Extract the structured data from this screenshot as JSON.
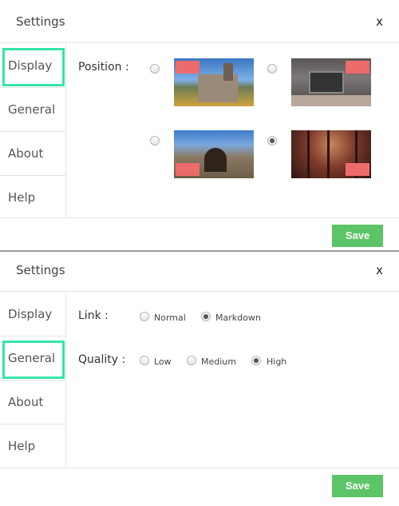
{
  "panels": [
    {
      "title": "Settings",
      "close": "x",
      "nav": [
        "Display",
        "General",
        "About",
        "Help"
      ],
      "active_nav": "Display",
      "position_label": "Position :",
      "positions": [
        {
          "image": "castle-tower",
          "checked": false
        },
        {
          "image": "laptop-desk",
          "checked": false
        },
        {
          "image": "castle-gate",
          "checked": true
        },
        {
          "image": "foggy-forest",
          "checked": false
        }
      ],
      "save_label": "Save"
    },
    {
      "title": "Settings",
      "close": "x",
      "nav": [
        "Display",
        "General",
        "About",
        "Help"
      ],
      "active_nav": "General",
      "link_label": "Link :",
      "link_options": [
        {
          "label": "Normal",
          "checked": false
        },
        {
          "label": "Markdown",
          "checked": true
        }
      ],
      "quality_label": "Quality :",
      "quality_options": [
        {
          "label": "Low",
          "checked": false
        },
        {
          "label": "Medium",
          "checked": false
        },
        {
          "label": "High",
          "checked": true
        }
      ],
      "save_label": "Save"
    }
  ],
  "colors": {
    "save_button": "#5cc567",
    "active_highlight": "#35e6a6",
    "marker": "#ee6b6b"
  }
}
